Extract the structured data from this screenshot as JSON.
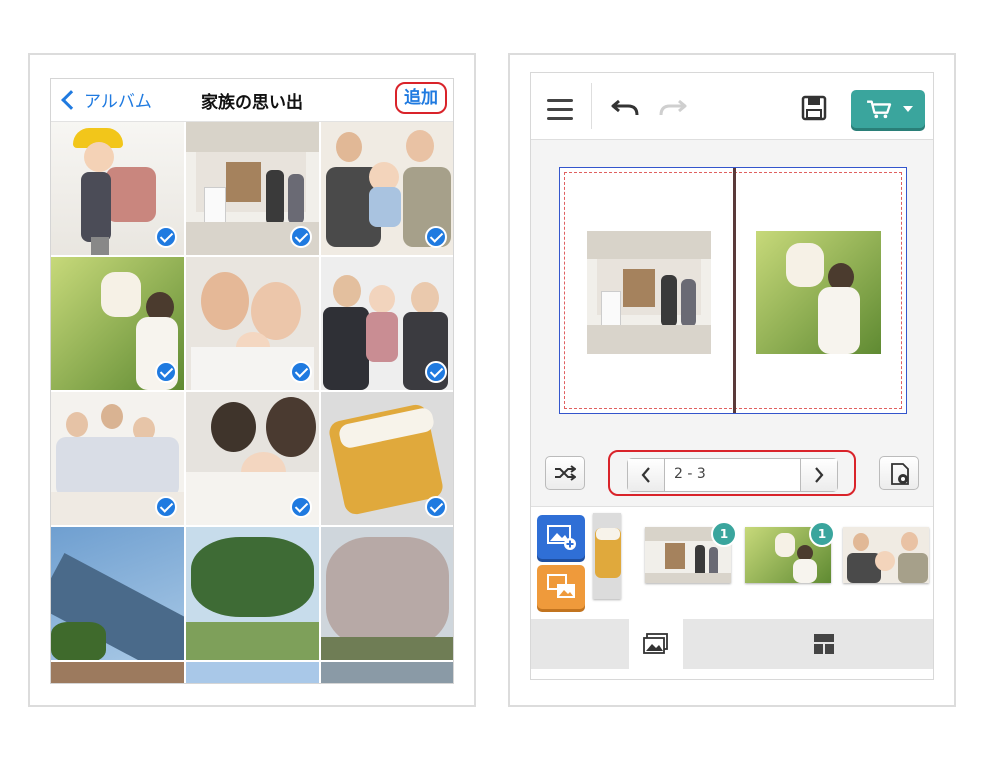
{
  "album": {
    "nav": {
      "back_label": "アルバム",
      "title": "家族の思い出",
      "add_label": "追加"
    },
    "photos": [
      {
        "subject": "child with yellow hat and randoseru",
        "selected": true
      },
      {
        "subject": "family in front of house",
        "selected": true
      },
      {
        "subject": "family on sofa with baby",
        "selected": true
      },
      {
        "subject": "mother lifting baby outdoors",
        "selected": true
      },
      {
        "subject": "parents with baby selfie",
        "selected": true
      },
      {
        "subject": "family with school child",
        "selected": true
      },
      {
        "subject": "three-generation family",
        "selected": true
      },
      {
        "subject": "parents with newborn",
        "selected": true
      },
      {
        "subject": "cake slice",
        "selected": true
      },
      {
        "subject": "sky and mountain",
        "selected": false
      },
      {
        "subject": "trees",
        "selected": false
      },
      {
        "subject": "cherry blossoms",
        "selected": false
      }
    ]
  },
  "editor": {
    "toolbar": {
      "menu_icon": "hamburger-icon",
      "undo_icon": "undo-icon",
      "redo_icon": "redo-icon",
      "save_icon": "save-icon",
      "cart_icon": "cart-icon"
    },
    "pager": {
      "pages": "2 - 3"
    },
    "tray": {
      "thumbnails": [
        {
          "subject": "cake slice",
          "badge": ""
        },
        {
          "subject": "family in front of house",
          "badge": "1"
        },
        {
          "subject": "mother lifting baby outdoors",
          "badge": "1"
        },
        {
          "subject": "family on sofa with baby",
          "badge": ""
        }
      ]
    },
    "tabs": [
      {
        "icon": "photos-tab-icon",
        "active": true
      },
      {
        "icon": "layout-tab-icon",
        "active": false
      }
    ],
    "colors": {
      "accent": "#3aa59d",
      "add_photo": "#2f6fd6",
      "swap_photo": "#ef9a3b",
      "highlight": "#d9232a"
    }
  }
}
